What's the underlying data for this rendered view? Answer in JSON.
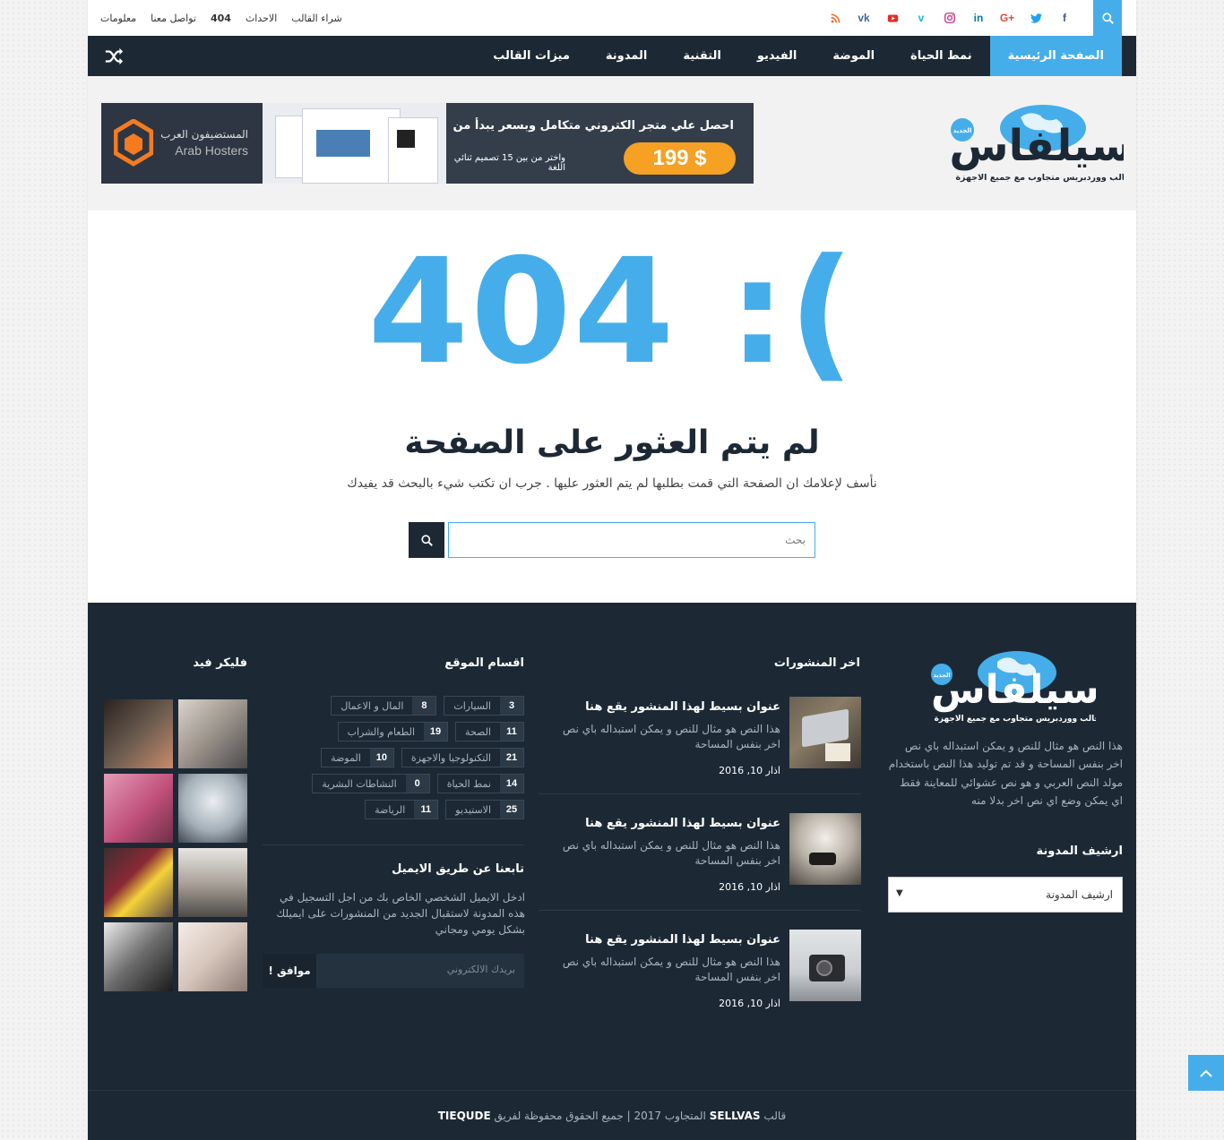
{
  "topbar": {
    "links": [
      "معلومات",
      "تواصل معنا",
      "404",
      "الاحداث",
      "شراء القالب"
    ],
    "social_icons": [
      "facebook-icon",
      "twitter-icon",
      "google-plus-icon",
      "linkedin-icon",
      "instagram-icon",
      "vimeo-icon",
      "youtube-icon",
      "vk-icon",
      "rss-icon"
    ]
  },
  "nav": {
    "items": [
      "الصفحة الرئيسية",
      "نمط الحياة",
      "الموضة",
      "الفيديو",
      "التقنية",
      "المدونة",
      "ميزات القالب"
    ]
  },
  "header": {
    "logo_text": "سيلفاس",
    "logo_badge": "الجديد",
    "logo_tagline": "قالب ووردبريس متجاوب مع جميع الاجهزة",
    "banner": {
      "brand_ar": "المستضيفون العرب",
      "brand_en": "Arab Hosters",
      "line1": "احصل علي متجر الكتروني متكامل وبسعر يبدأ من",
      "price": "199 $",
      "line2": "واختر من بين 15 تصميم ثنائي اللغة"
    }
  },
  "error": {
    "code": "404 :(",
    "title": "لم يتم العثور على الصفحة",
    "message": "نأسف لإعلامك ان الصفحة التي قمت بطلبها لم يتم العثور عليها . جرب ان تكتب شيء بالبحث قد يفيدك",
    "search_placeholder": "بحث"
  },
  "footer": {
    "about": {
      "text": "هذا النص هو مثال للنص و يمكن استبداله باي نص اخر بنفس المساحة و قد تم توليد هذا النص باستخدام مولد النص العربي و هو نص عشوائي للمعاينة فقط اي يمكن وضع اي نص اخر بدلا منه"
    },
    "archive": {
      "title": "ارشيف المدونة",
      "select_value": "ارشيف المدونة"
    },
    "recent": {
      "title": "اخر المنشورات",
      "posts": [
        {
          "title": "عنوان بسيط لهذا المنشور يقع هنا",
          "excerpt": "هذا النص هو مثال للنص و يمكن استبداله باي نص اخر بنفس المساحة",
          "date": "اذار 10, 2016"
        },
        {
          "title": "عنوان بسيط لهذا المنشور يقع هنا",
          "excerpt": "هذا النص هو مثال للنص و يمكن استبداله باي نص اخر بنفس المساحة",
          "date": "اذار 10, 2016"
        },
        {
          "title": "عنوان بسيط لهذا المنشور يقع هنا",
          "excerpt": "هذا النص هو مثال للنص و يمكن استبداله باي نص اخر بنفس المساحة",
          "date": "اذار 10, 2016"
        }
      ]
    },
    "categories": {
      "title": "اقسام الموقع",
      "rows": [
        [
          {
            "num": "3",
            "label": "السيارات"
          },
          {
            "num": "8",
            "label": "المال و الاعمال"
          }
        ],
        [
          {
            "num": "11",
            "label": "الصحة"
          },
          {
            "num": "19",
            "label": "الطعام والشراب"
          }
        ],
        [
          {
            "num": "21",
            "label": "التكنولوجيا والاجهزة"
          },
          {
            "num": "10",
            "label": "الموضة"
          }
        ],
        [
          {
            "num": "14",
            "label": "نمط الحياة"
          },
          {
            "num": "0",
            "label": "النشاطات البشرية"
          }
        ],
        [
          {
            "num": "25",
            "label": "الاستيديو"
          },
          {
            "num": "11",
            "label": "الرياضة"
          }
        ]
      ]
    },
    "subscribe": {
      "title": "تابعنا عن طريق الايميل",
      "text": "ادخل الايميل الشخصي الخاص بك من اجل التسجيل في هذه المدونة لاستقبال الجديد من المنشورات على ايميلك بشكل يومي ومجاني",
      "placeholder": "بريدك الالكتروني",
      "button": "موافق !"
    },
    "flickr": {
      "title": "فليكر فيد"
    }
  },
  "copyright": {
    "pre": "قالب",
    "brand": "SELLVAS",
    "mid": "المتجاوب 2017 | جميع الحقوق محفوظة لفريق",
    "team": "TIEQUDE"
  },
  "colors": {
    "accent": "#45aeea",
    "dark": "#1c2935"
  }
}
